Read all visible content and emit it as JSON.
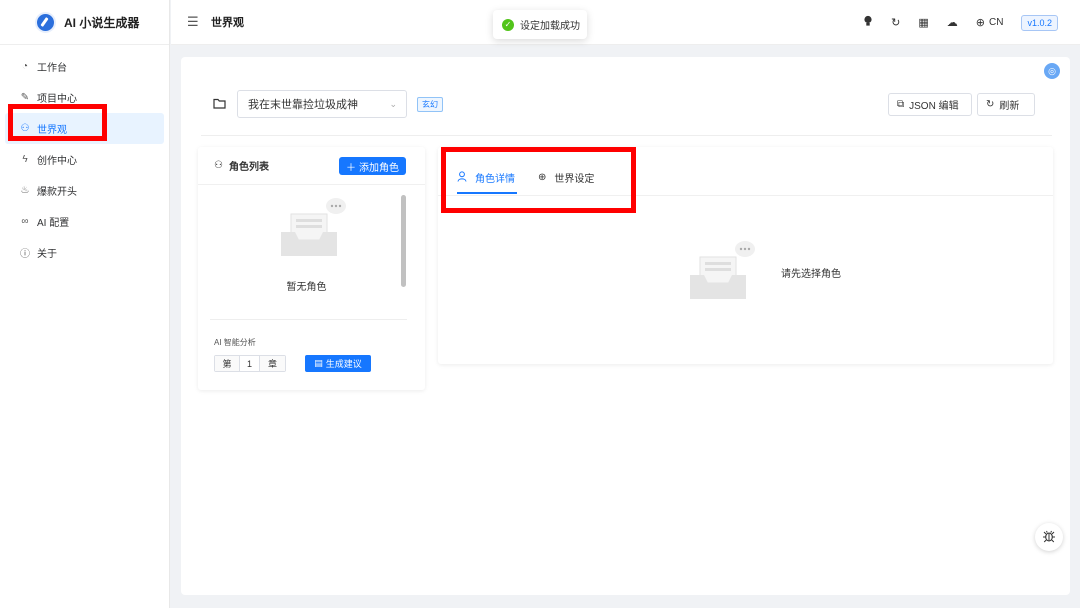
{
  "app": {
    "title": "AI 小说生成器"
  },
  "sidebar": {
    "items": [
      {
        "label": "工作台",
        "icon": "dashboard-icon",
        "glyph": "◔"
      },
      {
        "label": "项目中心",
        "icon": "edit-icon",
        "glyph": "✎"
      },
      {
        "label": "世界观",
        "icon": "people-icon",
        "glyph": "⚇"
      },
      {
        "label": "创作中心",
        "icon": "lightning-icon",
        "glyph": "ϟ"
      },
      {
        "label": "爆款开头",
        "icon": "fire-icon",
        "glyph": "♨"
      },
      {
        "label": "AI 配置",
        "icon": "link-icon",
        "glyph": "∞"
      },
      {
        "label": "关于",
        "icon": "info-icon",
        "glyph": "ⓘ"
      }
    ],
    "active_index": 2
  },
  "header": {
    "page_title": "世界观",
    "lang_label": "CN",
    "version": "v1.0.2"
  },
  "toast": {
    "message": "设定加载成功"
  },
  "toolbar": {
    "book_title": "我在末世靠捡垃圾成神",
    "genre_tag": "玄幻",
    "json_edit_label": "JSON 编辑",
    "refresh_label": "刷新"
  },
  "character_list": {
    "title": "角色列表",
    "add_label": "添加角色",
    "empty_text": "暂无角色",
    "ai_analysis_label": "AI 智能分析",
    "chapter_prefix": "第",
    "chapter_value": "1",
    "chapter_suffix": "章",
    "generate_label": "生成建议"
  },
  "detail_panel": {
    "tabs": [
      {
        "label": "角色详情",
        "icon": "user-icon"
      },
      {
        "label": "世界设定",
        "icon": "globe-icon"
      }
    ],
    "active_tab": 0,
    "empty_text": "请先选择角色"
  },
  "colors": {
    "primary": "#1677ff",
    "success": "#52c41a",
    "annotation": "#ff0000"
  }
}
